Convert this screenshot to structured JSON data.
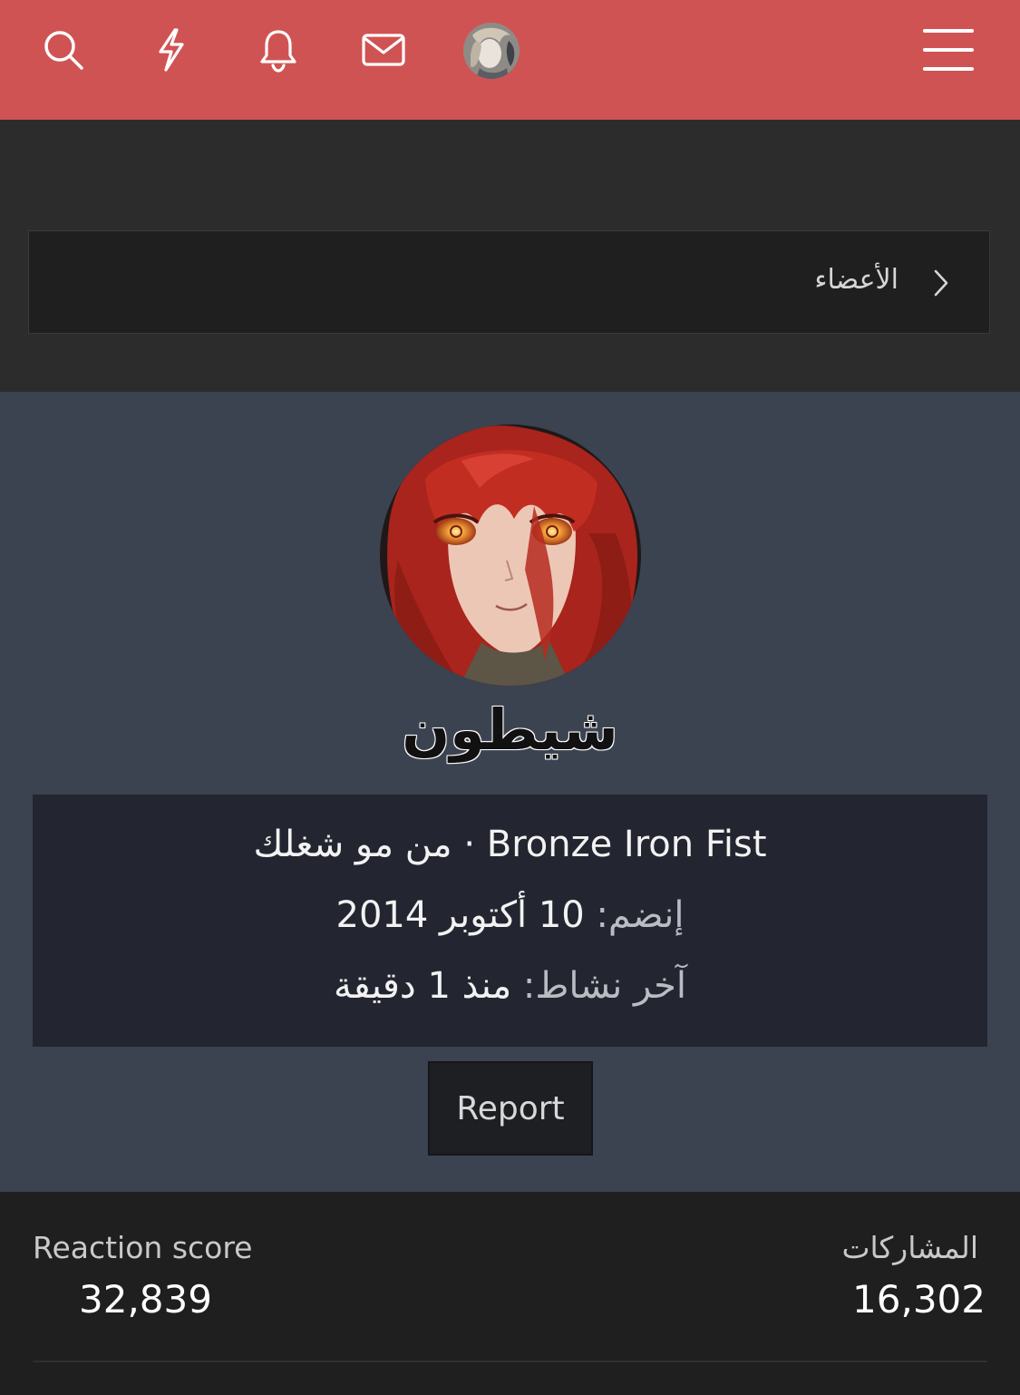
{
  "header": {
    "icons": [
      "search-icon",
      "lightning-icon",
      "bell-icon",
      "mail-icon"
    ],
    "menu_icon": "hamburger-menu-icon",
    "accent_color": "#d05353"
  },
  "breadcrumb": {
    "label": "الأعضاء",
    "chevron": "chevron-right-icon"
  },
  "profile": {
    "username": "شيطون",
    "title_prefix": "Bronze Iron Fist",
    "title_separator": "·",
    "title_suffix": "من مو شغلك",
    "joined_label": "إنضم:",
    "joined_value": "10 أكتوبر 2014",
    "last_seen_label": "آخر نشاط:",
    "last_seen_value": "منذ 1 دقيقة",
    "report_label": "Report"
  },
  "stats": {
    "reaction_label": "Reaction score",
    "reaction_value": "32,839",
    "posts_label": "المشاركات",
    "posts_value": "16,302"
  }
}
